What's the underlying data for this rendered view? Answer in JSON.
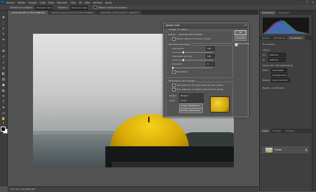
{
  "app": {
    "logo": "Ps"
  },
  "menu": {
    "items": [
      "Archivo",
      "Edición",
      "Imagen",
      "Capa",
      "Texto",
      "Selección",
      "Filtro",
      "3D",
      "Vista",
      "Ventana",
      "Ayuda"
    ]
  },
  "options": {
    "tamano_label": "Tamaño de muestra:",
    "tamano_value": "Promedio de 3 por 3",
    "muestra_label": "Muestra:",
    "muestra_value": "Todas las capas",
    "mostrar_label": "Mostrar anillo de muestra"
  },
  "tabs": [
    "_DSC0162.NEF al 25% (RGB/16*)",
    "ejemplo-ajuste-color.tif al 25% (RGB/8*)",
    "_DSC0162 al 25% (Capa 1, RGB/16*)"
  ],
  "status": {
    "text": "25%   Doc: 63,9M/63,9M"
  },
  "dialog": {
    "title": "Igualar color",
    "target_legend": "Imagen de destino",
    "target_label": "Destino:",
    "target_value": "_DSC0162.NEF (RGB/16)",
    "ignore_selection": "Ignorar selección al aplicar ajuste",
    "options_legend": "Opciones de imagen",
    "luminance_label": "Luminancia",
    "luminance_value": "100",
    "intensity_label": "Intensidad del color",
    "intensity_value": "100",
    "fade_label": "Transición",
    "fade_value": "0",
    "neutralize_label": "Neutralizar",
    "stats_legend": "Estadísticas de la imagen",
    "use_selection_source": "Usar selección en origen para calcular colores",
    "use_selection_target": "Usar selección en destino para calcular ajuste",
    "source_label": "Origen:",
    "source_value": "Ninguno",
    "layer_label": "Capa:",
    "layer_value": "Fondo",
    "load_button": "Cargar estadísticas...",
    "save_button": "Guardar estadísticas...",
    "ok_button": "OK",
    "cancel_button": "Cancelar",
    "preview_label": "Previsualizar"
  },
  "right": {
    "top_tabs": [
      "Histograma",
      "Navegador"
    ],
    "prop_tabs": [
      "Propiedades",
      "Ajustes",
      "Bibliotecas"
    ],
    "doc_label": "Documento",
    "canvas_label": "Lienzo",
    "w_label": "An",
    "w_value": "6000 px",
    "h_label": "Al",
    "h_value": "4000 px",
    "res_label": "Resolución: 300 píxeles/pulg",
    "mode_label": "Modo",
    "mode_value": "Color RGB",
    "bits_value": "16 bits/canal",
    "fill_label": "Relleno",
    "fill_value": "Color de fondo",
    "rulers_label": "Reglas y cuadrículas",
    "layers_tabs": [
      "Capas",
      "Canales",
      "Trazados"
    ],
    "layer_name": "Fondo",
    "colors": {
      "hist_red": "#d83232",
      "hist_green": "#3bcf3b",
      "hist_blue": "#3a55e0"
    }
  }
}
